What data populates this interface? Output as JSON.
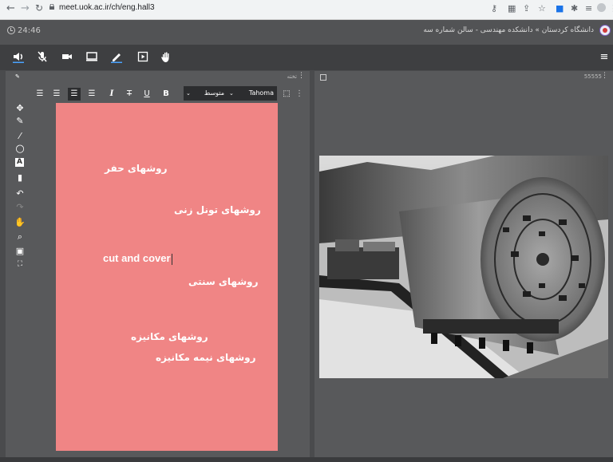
{
  "browser": {
    "url": "meet.uok.ac.ir/ch/eng.hall3",
    "icons": [
      "back-icon",
      "forward-icon",
      "reload-icon",
      "key-icon",
      "translate-icon",
      "share-icon",
      "star-icon",
      "extension-icon",
      "puzzle-icon",
      "playlist-icon",
      "profile-icon",
      "menu-dots-icon"
    ]
  },
  "header": {
    "time": "24:46",
    "breadcrumb": "دانشگاه کردستان » دانشکده مهندسی - سالن شماره سه"
  },
  "toolbar": {
    "tools": [
      "speaker-icon",
      "mic-muted-icon",
      "camera-icon",
      "screen-share-icon",
      "whiteboard-pen-icon",
      "media-icon",
      "raise-hand-icon"
    ],
    "active_tools": [
      "speaker-icon",
      "whiteboard-pen-icon"
    ],
    "menu": "hamburger-menu-icon"
  },
  "left_panel": {
    "label": "تخته",
    "text_toolbar": {
      "buttons": [
        "align-right",
        "align-justify",
        "align-center",
        "align-left",
        "italic",
        "strikethrough",
        "underline",
        "bold"
      ],
      "active": "align-center",
      "font_size": "متوسط",
      "font_family": "Tahoma"
    },
    "board_color": "#f08585",
    "board_lines": [
      "روشهای حفر",
      "روشهای تونل زنی",
      "cut and cover",
      "روشهای سنتی",
      "روشهای مکانیزه",
      "روشهای نیمه مکانیزه"
    ]
  },
  "right_panel": {
    "label": "55555"
  }
}
